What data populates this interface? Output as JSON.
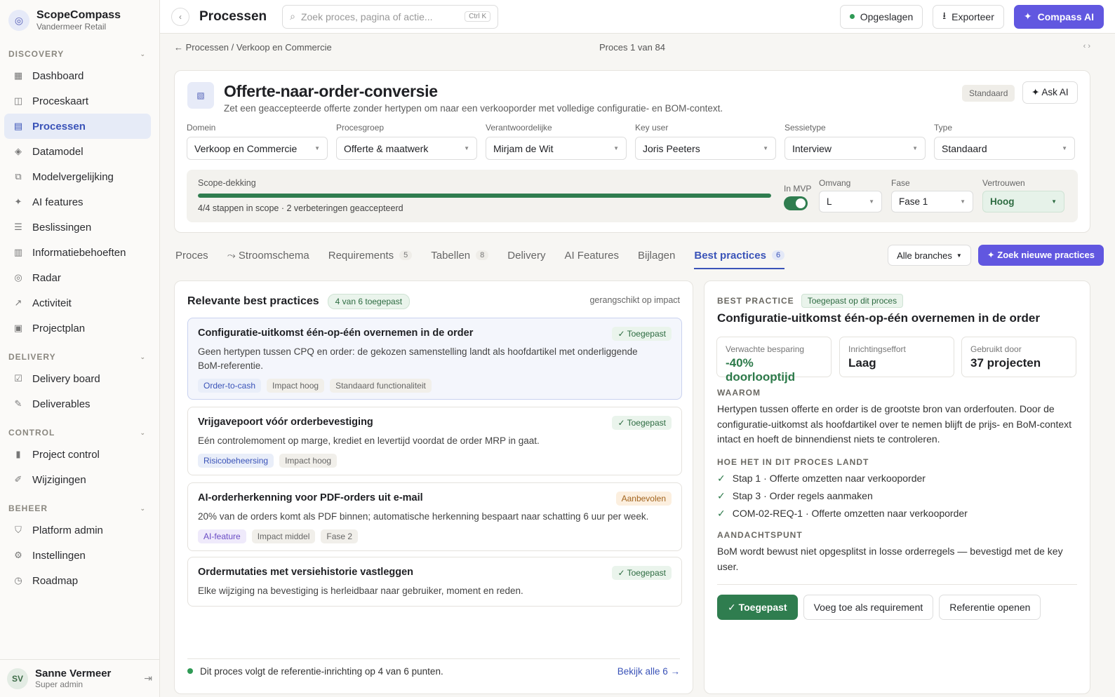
{
  "app": {
    "name": "ScopeCompass",
    "org": "Vandermeer Retail"
  },
  "sidebar": {
    "sections": [
      {
        "title": "DISCOVERY",
        "items": [
          {
            "label": "Dashboard",
            "icon": "grid-icon"
          },
          {
            "label": "Proceskaart",
            "icon": "map-icon"
          },
          {
            "label": "Processen",
            "icon": "list-icon",
            "active": true
          },
          {
            "label": "Datamodel",
            "icon": "diamond-icon"
          },
          {
            "label": "Modelvergelijking",
            "icon": "compare-icon"
          },
          {
            "label": "AI features",
            "icon": "sparkle-icon"
          },
          {
            "label": "Beslissingen",
            "icon": "lines-icon"
          },
          {
            "label": "Informatiebehoeften",
            "icon": "table-icon"
          },
          {
            "label": "Radar",
            "icon": "radar-icon"
          },
          {
            "label": "Activiteit",
            "icon": "activity-icon"
          },
          {
            "label": "Projectplan",
            "icon": "plan-icon"
          }
        ]
      },
      {
        "title": "DELIVERY",
        "items": [
          {
            "label": "Delivery board",
            "icon": "checkbox-icon"
          },
          {
            "label": "Deliverables",
            "icon": "pencil-icon"
          }
        ]
      },
      {
        "title": "CONTROL",
        "items": [
          {
            "label": "Project control",
            "icon": "bar-icon"
          },
          {
            "label": "Wijzigingen",
            "icon": "edit-icon"
          }
        ]
      },
      {
        "title": "BEHEER",
        "items": [
          {
            "label": "Platform admin",
            "icon": "shield-icon"
          },
          {
            "label": "Instellingen",
            "icon": "gear-icon"
          },
          {
            "label": "Roadmap",
            "icon": "clock-icon"
          }
        ]
      }
    ],
    "user": {
      "initials": "SV",
      "name": "Sanne Vermeer",
      "role": "Super admin"
    }
  },
  "topbar": {
    "title": "Processen",
    "search_placeholder": "Zoek proces, pagina of actie...",
    "shortcut": "Ctrl K",
    "saved_label": "Opgeslagen",
    "export_label": "Exporteer",
    "ai_label": "Compass AI"
  },
  "breadcrumb": {
    "back": "← Processen / Verkoop en Commercie",
    "position": "Proces 1 van 84",
    "nav": "‹ ›"
  },
  "process": {
    "title": "Offerte-naar-order-conversie",
    "description": "Zet een geaccepteerde offerte zonder hertypen om naar een verkooporder met volledige configuratie- en BOM-context.",
    "type_badge": "Standaard",
    "ask_ai": "✦ Ask AI",
    "fields": [
      {
        "label": "Domein",
        "value": "Verkoop en Commercie"
      },
      {
        "label": "Procesgroep",
        "value": "Offerte & maatwerk"
      },
      {
        "label": "Verantwoordelijke",
        "value": "Mirjam de Wit"
      },
      {
        "label": "Key user",
        "value": "Joris Peeters"
      },
      {
        "label": "Sessietype",
        "value": "Interview"
      },
      {
        "label": "Type",
        "value": "Standaard"
      }
    ],
    "scope": {
      "label": "Scope-dekking",
      "progress": 1.0,
      "summary": "4/4 stappen in scope · 2 verbeteringen geaccepteerd",
      "mvp_label": "In MVP",
      "mvp_on": true,
      "omvang_label": "Omvang",
      "omvang": "L",
      "fase_label": "Fase",
      "fase": "Fase 1",
      "vertrouwen_label": "Vertrouwen",
      "vertrouwen": "Hoog"
    }
  },
  "tabs": [
    {
      "label": "Proces"
    },
    {
      "label": "⤳ Stroomschema"
    },
    {
      "label": "Requirements",
      "count": "5"
    },
    {
      "label": "Tabellen",
      "count": "8"
    },
    {
      "label": "Delivery"
    },
    {
      "label": "AI Features"
    },
    {
      "label": "Bijlagen"
    },
    {
      "label": "Best practices",
      "count": "6",
      "active": true
    }
  ],
  "tab_actions": {
    "branches": "Alle branches",
    "find": "✦ Zoek nieuwe practices"
  },
  "practices": {
    "title": "Relevante best practices",
    "applied_badge": "4 van 6 toegepast",
    "sort": "gerangschikt op impact",
    "items": [
      {
        "title": "Configuratie-uitkomst één-op-één overnemen in de order",
        "status": "✓ Toegepast",
        "status_type": "applied",
        "description": "Geen hertypen tussen CPQ en order: de gekozen samenstelling landt als hoofdartikel met onderliggende BoM-referentie.",
        "tags": [
          {
            "label": "Order-to-cash",
            "style": "blue"
          },
          {
            "label": "Impact hoog",
            "style": "grey"
          },
          {
            "label": "Standaard functionaliteit",
            "style": "grey"
          }
        ]
      },
      {
        "title": "Vrijgavepoort vóór orderbevestiging",
        "status": "✓ Toegepast",
        "status_type": "applied",
        "description": "Eén controlemoment op marge, krediet en levertijd voordat de order MRP in gaat.",
        "tags": [
          {
            "label": "Risicobeheersing",
            "style": "blue"
          },
          {
            "label": "Impact hoog",
            "style": "grey"
          }
        ]
      },
      {
        "title": "AI-orderherkenning voor PDF-orders uit e-mail",
        "status": "Aanbevolen",
        "status_type": "rec",
        "description": "20% van de orders komt als PDF binnen; automatische herkenning bespaart naar schatting 6 uur per week.",
        "tags": [
          {
            "label": "AI-feature",
            "style": "purple"
          },
          {
            "label": "Impact middel",
            "style": "grey"
          },
          {
            "label": "Fase 2",
            "style": "grey"
          }
        ]
      },
      {
        "title": "Ordermutaties met versiehistorie vastleggen",
        "status": "✓ Toegepast",
        "status_type": "applied",
        "description": "Elke wijziging na bevestiging is herleidbaar naar gebruiker, moment en reden.",
        "tags": []
      }
    ],
    "footer_text": "Dit proces volgt de referentie-inrichting op 4 van 6 punten.",
    "footer_link": "Bekijk alle 6 →"
  },
  "detail": {
    "eyebrow": "BEST PRACTICE",
    "applied_badge": "Toegepast op dit proces",
    "title": "Configuratie-uitkomst één-op-één overnemen in de order",
    "stats": [
      {
        "label": "Verwachte besparing",
        "value": "-40% doorlooptijd"
      },
      {
        "label": "Inrichtingseffort",
        "value": "Laag"
      },
      {
        "label": "Gebruikt door",
        "value": "37 projecten"
      }
    ],
    "why_title": "WAAROM",
    "why_text": "Hertypen tussen offerte en order is de grootste bron van orderfouten. Door de configuratie-uitkomst als hoofdartikel over te nemen blijft de prijs- en BoM-context intact en hoeft de binnendienst niets te controleren.",
    "how_title": "HOE HET IN DIT PROCES LANDT",
    "how_items": [
      "Stap 1 · Offerte omzetten naar verkooporder",
      "Stap 3 · Order regels aanmaken",
      "COM-02-REQ-1 · Offerte omzetten naar verkooporder"
    ],
    "note_title": "AANDACHTSPUNT",
    "note_text": "BoM wordt bewust niet opgesplitst in losse orderregels — bevestigd met de key user.",
    "actions": {
      "applied": "✓ Toegepast",
      "add_req": "Voeg toe als requirement",
      "open_ref": "Referentie openen"
    }
  }
}
